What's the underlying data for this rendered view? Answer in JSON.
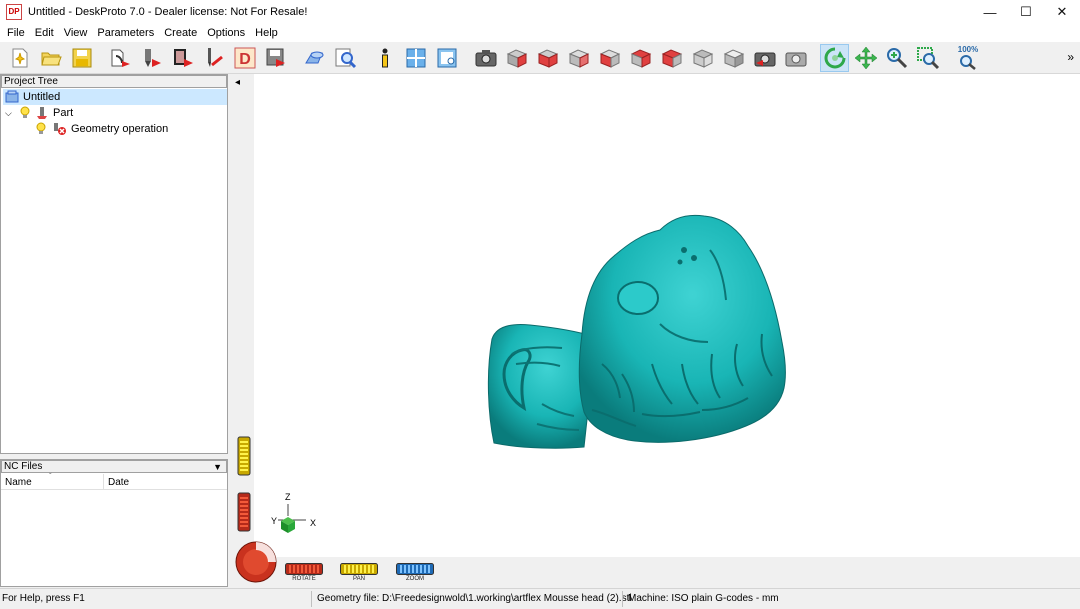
{
  "window": {
    "title": "Untitled - DeskProto 7.0 - Dealer license: Not For Resale!",
    "app_icon_text": "DP",
    "minimize": "—",
    "maximize": "☐",
    "close": "✕"
  },
  "menu": [
    "File",
    "Edit",
    "View",
    "Parameters",
    "Create",
    "Options",
    "Help"
  ],
  "toolbar": {
    "zoom_label": "100%",
    "overflow": "»"
  },
  "project_tree": {
    "header": "Project Tree",
    "items": [
      {
        "label": "Untitled"
      },
      {
        "label": "Part"
      },
      {
        "label": "Geometry operation"
      }
    ]
  },
  "nc_files": {
    "header": "NC Files",
    "columns": [
      "Name",
      "Date"
    ]
  },
  "viewport": {
    "collapse_arrow": "◂",
    "axes": {
      "z": "Z",
      "y": "Y",
      "x": "X"
    },
    "controls": [
      "ROTATE",
      "PAN",
      "ZOOM"
    ],
    "model_color": "#19b5b5"
  },
  "status": {
    "help": "For Help, press F1",
    "geometry": "Geometry file: D:\\Freedesignwold\\1.working\\artflex Mousse head (2).stl",
    "machine": "Machine: ISO plain G-codes - mm"
  }
}
